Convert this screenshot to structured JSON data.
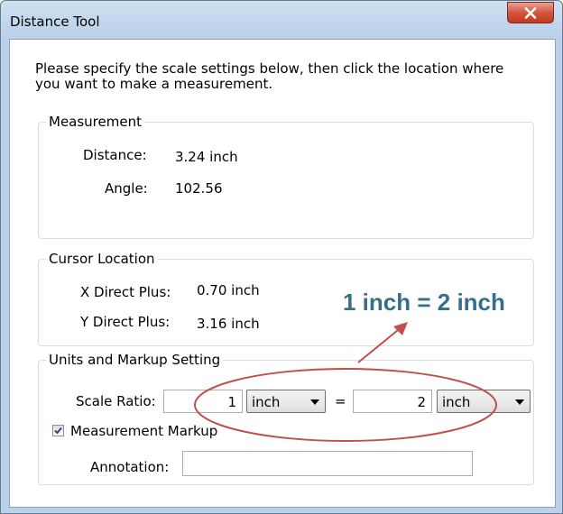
{
  "window": {
    "title": "Distance Tool"
  },
  "intro_text": "Please specify the scale settings below, then click the location where you want to make a measurement.",
  "measurement": {
    "legend": "Measurement",
    "distance_label": "Distance:",
    "distance_value": "3.24 inch",
    "angle_label": "Angle:",
    "angle_value": "102.56"
  },
  "cursor_location": {
    "legend": "Cursor Location",
    "x_label": "X Direct Plus:",
    "x_value": "0.70 inch",
    "y_label": "Y Direct Plus:",
    "y_value": "3.16 inch"
  },
  "units_markup": {
    "legend": "Units and Markup Setting",
    "scale_ratio_label": "Scale Ratio:",
    "scale_left_value": "1",
    "scale_left_unit": "inch",
    "equals": "=",
    "scale_right_value": "2",
    "scale_right_unit": "inch",
    "measurement_markup_label": "Measurement Markup",
    "measurement_markup_checked": true,
    "annotation_label": "Annotation:",
    "annotation_value": ""
  },
  "callout": {
    "text": "1 inch = 2 inch",
    "color": "#366f8d",
    "annotation_color": "#c0504d"
  }
}
